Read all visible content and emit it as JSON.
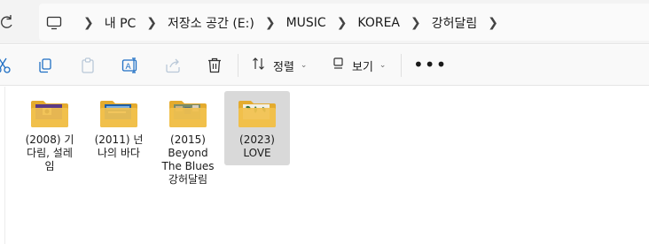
{
  "breadcrumb": {
    "items": [
      "내 PC",
      "저장소 공간 (E:)",
      "MUSIC",
      "KOREA",
      "강허달림"
    ]
  },
  "toolbar": {
    "sort_label": "정렬",
    "view_label": "보기",
    "icons": [
      "cut-icon",
      "copy-icon",
      "paste-icon",
      "rename-icon",
      "share-icon",
      "delete-icon"
    ]
  },
  "folders": [
    {
      "label": "(2008) 기\n다림, 설레\n임",
      "selected": false,
      "art": "purple"
    },
    {
      "label": "(2011) 넌\n나의 바다",
      "selected": false,
      "art": "blue"
    },
    {
      "label": "(2015)\nBeyond\nThe Blues\n강허달림",
      "selected": false,
      "art": "green"
    },
    {
      "label": "(2023)\nLOVE",
      "selected": true,
      "art": "leaf"
    }
  ],
  "colors": {
    "folder_body": "#f2c14e",
    "folder_back": "#e4ab2e",
    "selection": "#d9d9d9"
  }
}
